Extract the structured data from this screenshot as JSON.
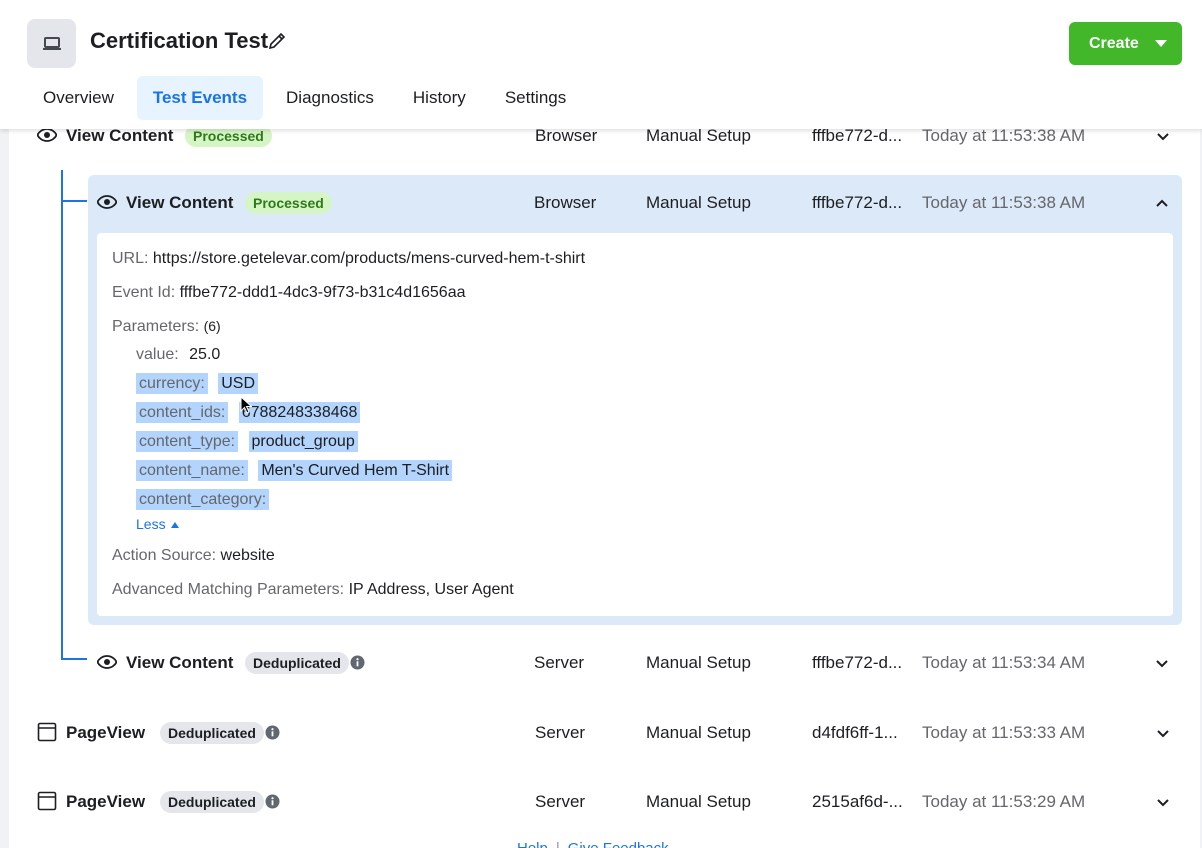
{
  "header": {
    "title": "Certification Test",
    "create_label": "Create"
  },
  "tabs": [
    {
      "label": "Overview"
    },
    {
      "label": "Test Events"
    },
    {
      "label": "Diagnostics"
    },
    {
      "label": "History"
    },
    {
      "label": "Settings"
    }
  ],
  "events": [
    {
      "name": "View Content",
      "status": "Processed",
      "channel": "Browser",
      "setup": "Manual Setup",
      "id_short": "fffbe772-d...",
      "time": "Today at 11:53:38 AM"
    },
    {
      "name": "View Content",
      "status": "Processed",
      "channel": "Browser",
      "setup": "Manual Setup",
      "id_short": "fffbe772-d...",
      "time": "Today at 11:53:38 AM"
    },
    {
      "name": "View Content",
      "status": "Deduplicated",
      "channel": "Server",
      "setup": "Manual Setup",
      "id_short": "fffbe772-d...",
      "time": "Today at 11:53:34 AM"
    },
    {
      "name": "PageView",
      "status": "Deduplicated",
      "channel": "Server",
      "setup": "Manual Setup",
      "id_short": "d4fdf6ff-1...",
      "time": "Today at 11:53:33 AM"
    },
    {
      "name": "PageView",
      "status": "Deduplicated",
      "channel": "Server",
      "setup": "Manual Setup",
      "id_short": "2515af6d-...",
      "time": "Today at 11:53:29 AM"
    }
  ],
  "details": {
    "url_label": "URL:",
    "url": "https://store.getelevar.com/products/mens-curved-hem-t-shirt",
    "event_id_label": "Event Id:",
    "event_id": "fffbe772-ddd1-4dc3-9f73-b31c4d1656aa",
    "parameters_label": "Parameters:",
    "parameters_count": "(6)",
    "parameters": [
      {
        "key": "value:",
        "value": "25.0"
      },
      {
        "key": "currency:",
        "value": "USD"
      },
      {
        "key": "content_ids:",
        "value": "6788248338468"
      },
      {
        "key": "content_type:",
        "value": "product_group"
      },
      {
        "key": "content_name:",
        "value": "Men's Curved Hem T-Shirt"
      },
      {
        "key": "content_category:",
        "value": ""
      }
    ],
    "less_label": "Less",
    "action_source_label": "Action Source:",
    "action_source": "website",
    "amp_label": "Advanced Matching Parameters:",
    "amp": "IP Address, User Agent"
  },
  "footer": {
    "help_label": "Help",
    "feedback_label": "Give Feedback"
  },
  "colors": {
    "accent": "#1b74e4",
    "create_green": "#42b72a",
    "processed_bg": "#d6f5c6",
    "selection": "#b3d4fc"
  }
}
